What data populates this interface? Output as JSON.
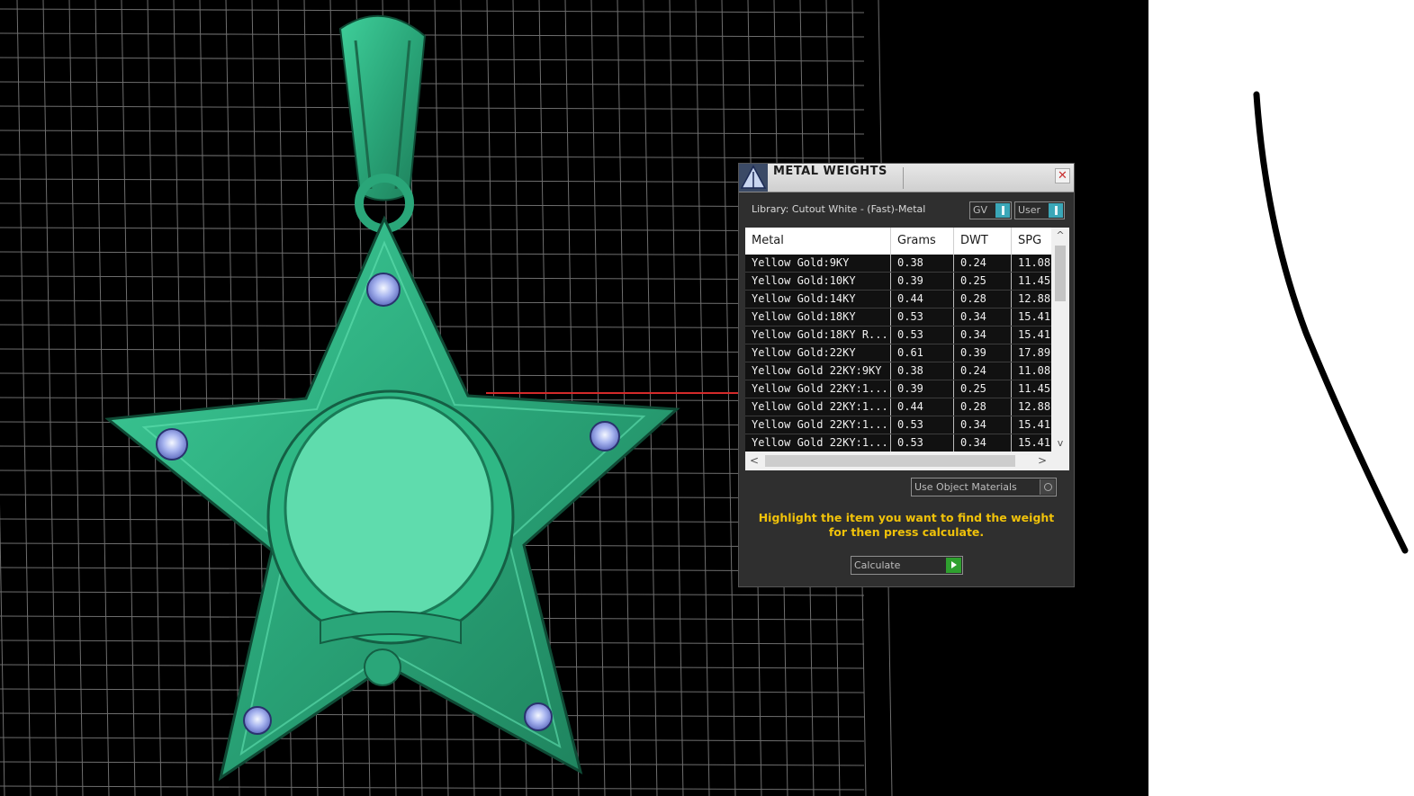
{
  "dialog": {
    "title": "METAL WEIGHTS",
    "close_glyph": "✕",
    "library": "Library: Cutout White - (Fast)-Metal",
    "toggle_gv": "GV",
    "toggle_user": "User",
    "columns": [
      "Metal",
      "Grams",
      "DWT",
      "SPG"
    ],
    "rows": [
      [
        "Yellow Gold:9KY",
        "0.38",
        "0.24",
        "11.08"
      ],
      [
        "Yellow Gold:10KY",
        "0.39",
        "0.25",
        "11.45"
      ],
      [
        "Yellow Gold:14KY",
        "0.44",
        "0.28",
        "12.88"
      ],
      [
        "Yellow Gold:18KY",
        "0.53",
        "0.34",
        "15.41"
      ],
      [
        "Yellow Gold:18KY R...",
        "0.53",
        "0.34",
        "15.41"
      ],
      [
        "Yellow Gold:22KY",
        "0.61",
        "0.39",
        "17.89"
      ],
      [
        "Yellow Gold 22KY:9KY",
        "0.38",
        "0.24",
        "11.08"
      ],
      [
        "Yellow Gold 22KY:1...",
        "0.39",
        "0.25",
        "11.45"
      ],
      [
        "Yellow Gold 22KY:1...",
        "0.44",
        "0.28",
        "12.88"
      ],
      [
        "Yellow Gold 22KY:1...",
        "0.53",
        "0.34",
        "15.41"
      ],
      [
        "Yellow Gold 22KY:1...",
        "0.53",
        "0.34",
        "15.41"
      ]
    ],
    "scroll_up": "^",
    "scroll_down": "v",
    "scroll_left": "<",
    "scroll_right": ">",
    "use_object_materials": "Use Object Materials",
    "hint": "Highlight the item you want to find the weight for then press calculate.",
    "calculate": "Calculate"
  },
  "viewport": {
    "model": "star-pendant",
    "model_color": "#3fbf8f",
    "grid_color": "#6e6e6e",
    "background": "#000000"
  },
  "colors": {
    "hint_text": "#f0c20a",
    "toggle_on": "#3aa7b8",
    "calculate_go": "#2fa02f"
  }
}
